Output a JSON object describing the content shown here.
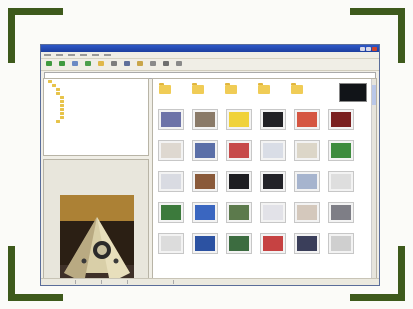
{
  "frame": {
    "accent": "#3e5a1c"
  },
  "window": {
    "title": "",
    "menu": [],
    "toolbar": [
      "",
      "",
      "",
      "",
      "",
      "",
      "",
      "",
      "",
      "",
      ""
    ],
    "address": "",
    "tree": [
      "",
      "",
      "",
      "",
      "",
      "",
      "",
      "",
      "",
      "",
      ""
    ],
    "folders": [
      "",
      "",
      "",
      "",
      ""
    ],
    "thumbnails": [
      {
        "label": "",
        "color": "#6d73a8"
      },
      {
        "label": "",
        "color": "#8a7a68"
      },
      {
        "label": "",
        "color": "#f0d23a"
      },
      {
        "label": "",
        "color": "#222226"
      },
      {
        "label": "",
        "color": "#d55642"
      },
      {
        "label": "",
        "color": "#7a1f1f"
      },
      {
        "label": "",
        "color": "#ded8d0"
      },
      {
        "label": "",
        "color": "#5b6fa8"
      },
      {
        "label": "",
        "color": "#c74a4a"
      },
      {
        "label": "",
        "color": "#d9dde6"
      },
      {
        "label": "",
        "color": "#dcd6c8"
      },
      {
        "label": "",
        "color": "#3e8c3e"
      },
      {
        "label": "",
        "color": "#d9dbe2"
      },
      {
        "label": "",
        "color": "#8a5a3a"
      },
      {
        "label": "",
        "color": "#1e1e22"
      },
      {
        "label": "",
        "color": "#222228"
      },
      {
        "label": "",
        "color": "#a6b4ce"
      },
      {
        "label": "",
        "color": "#dedede"
      },
      {
        "label": "",
        "color": "#3c7a3c"
      },
      {
        "label": "",
        "color": "#3a66c0"
      },
      {
        "label": "",
        "color": "#5c7a4c"
      },
      {
        "label": "",
        "color": "#e2e2e8"
      },
      {
        "label": "",
        "color": "#d4c8bc"
      },
      {
        "label": "",
        "color": "#7e7e86"
      },
      {
        "label": "",
        "color": "#dcdcdc"
      },
      {
        "label": "",
        "color": "#2c52a2"
      },
      {
        "label": "",
        "color": "#3c6c40"
      },
      {
        "label": "",
        "color": "#c64242"
      },
      {
        "label": "",
        "color": "#3a3e5a"
      },
      {
        "label": "",
        "color": "#cfcfcf"
      }
    ],
    "status": [
      "",
      "",
      "",
      ""
    ]
  }
}
